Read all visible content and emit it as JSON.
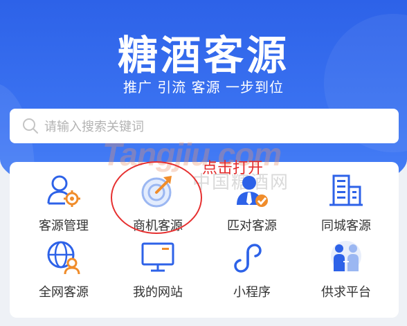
{
  "header": {
    "title": "糖酒客源",
    "subtitle": "推广 引流 客源 一步到位"
  },
  "search": {
    "placeholder": "请输入搜索关键词",
    "icon": "search-icon"
  },
  "watermark": {
    "brand": "Tangjiu.com",
    "cn": "中国糖酒网"
  },
  "annotation": {
    "hint": "点击打开"
  },
  "menu": [
    {
      "label": "客源管理",
      "icon": "user-gear-icon"
    },
    {
      "label": "商机客源",
      "icon": "target-icon"
    },
    {
      "label": "匹对客源",
      "icon": "user-check-icon"
    },
    {
      "label": "同城客源",
      "icon": "building-icon"
    },
    {
      "label": "全网客源",
      "icon": "globe-user-icon"
    },
    {
      "label": "我的网站",
      "icon": "monitor-icon"
    },
    {
      "label": "小程序",
      "icon": "mini-program-icon"
    },
    {
      "label": "供求平台",
      "icon": "people-icon"
    }
  ],
  "colors": {
    "brand_blue": "#2d62e8",
    "accent_orange": "#f08c2a",
    "annotation_red": "#e32b2b"
  }
}
